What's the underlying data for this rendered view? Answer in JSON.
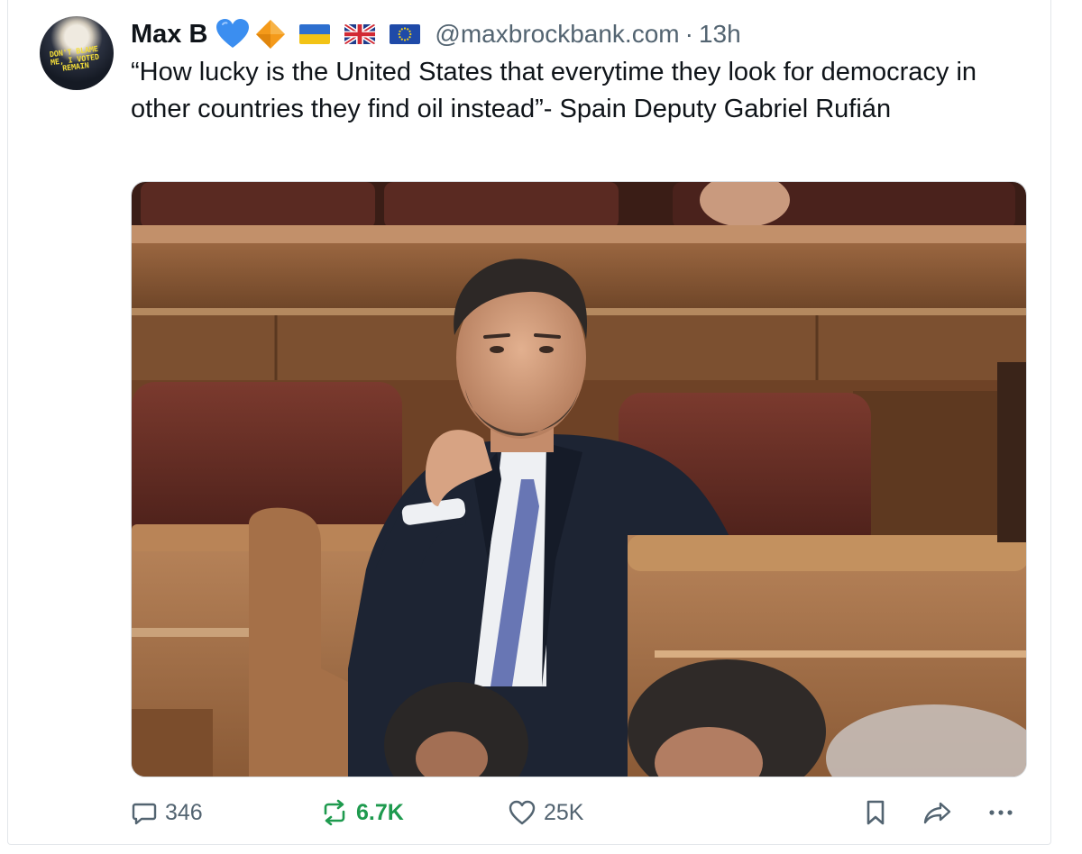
{
  "post": {
    "author": {
      "display_name": "Max B",
      "handle": "@maxbrockbank.com",
      "avatar_text": "DON'T BLAME ME, I VOTED REMAIN",
      "avatar_lines": [
        "DON'T BLAME",
        "ME, I VOTED",
        "REMAIN"
      ],
      "badges": [
        "blue-heart-icon",
        "orange-diamond-icon",
        "ukraine-flag-icon",
        "uk-flag-icon",
        "eu-flag-icon"
      ]
    },
    "separator": "·",
    "time": "13h",
    "text": "“How lucky is the United States that everytime they look for democracy in other countries they find oil instead”- Spain Deputy Gabriel Rufián",
    "actions": {
      "replies": "346",
      "reposts": "6.7K",
      "likes": "25K"
    }
  },
  "colors": {
    "text": "#0f1419",
    "muted": "#536471",
    "repost": "#1e9a4e",
    "heart_badge": "#3b8ef0",
    "diamond_badge": "#f49a1a"
  },
  "icons": {
    "reply": "speech-bubble-icon",
    "repost": "repost-arrows-icon",
    "like": "heart-outline-icon",
    "bookmark": "bookmark-icon",
    "share": "share-arrow-icon",
    "more": "more-dots-icon"
  }
}
